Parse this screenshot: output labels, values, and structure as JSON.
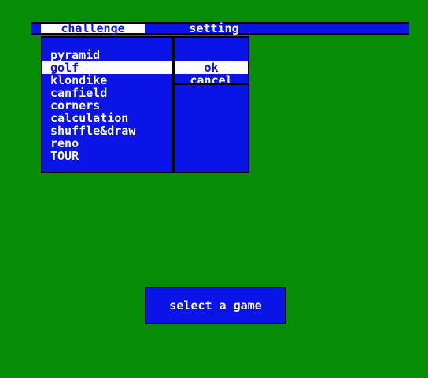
{
  "menu": {
    "challenge_label": "challenge",
    "setting_label": "setting"
  },
  "games": [
    "pyramid",
    "golf",
    "klondike",
    "canfield",
    "corners",
    "calculation",
    "shuffle&draw",
    "reno",
    "TOUR"
  ],
  "selected_game": "golf",
  "confirm": {
    "ok_label": "ok",
    "cancel_label": "cancel",
    "selected": "ok"
  },
  "status_message": "select a game",
  "colors": {
    "background": "#078c07",
    "panel": "#0a14e6",
    "highlight": "#ffffff",
    "text": "#ffffff"
  }
}
